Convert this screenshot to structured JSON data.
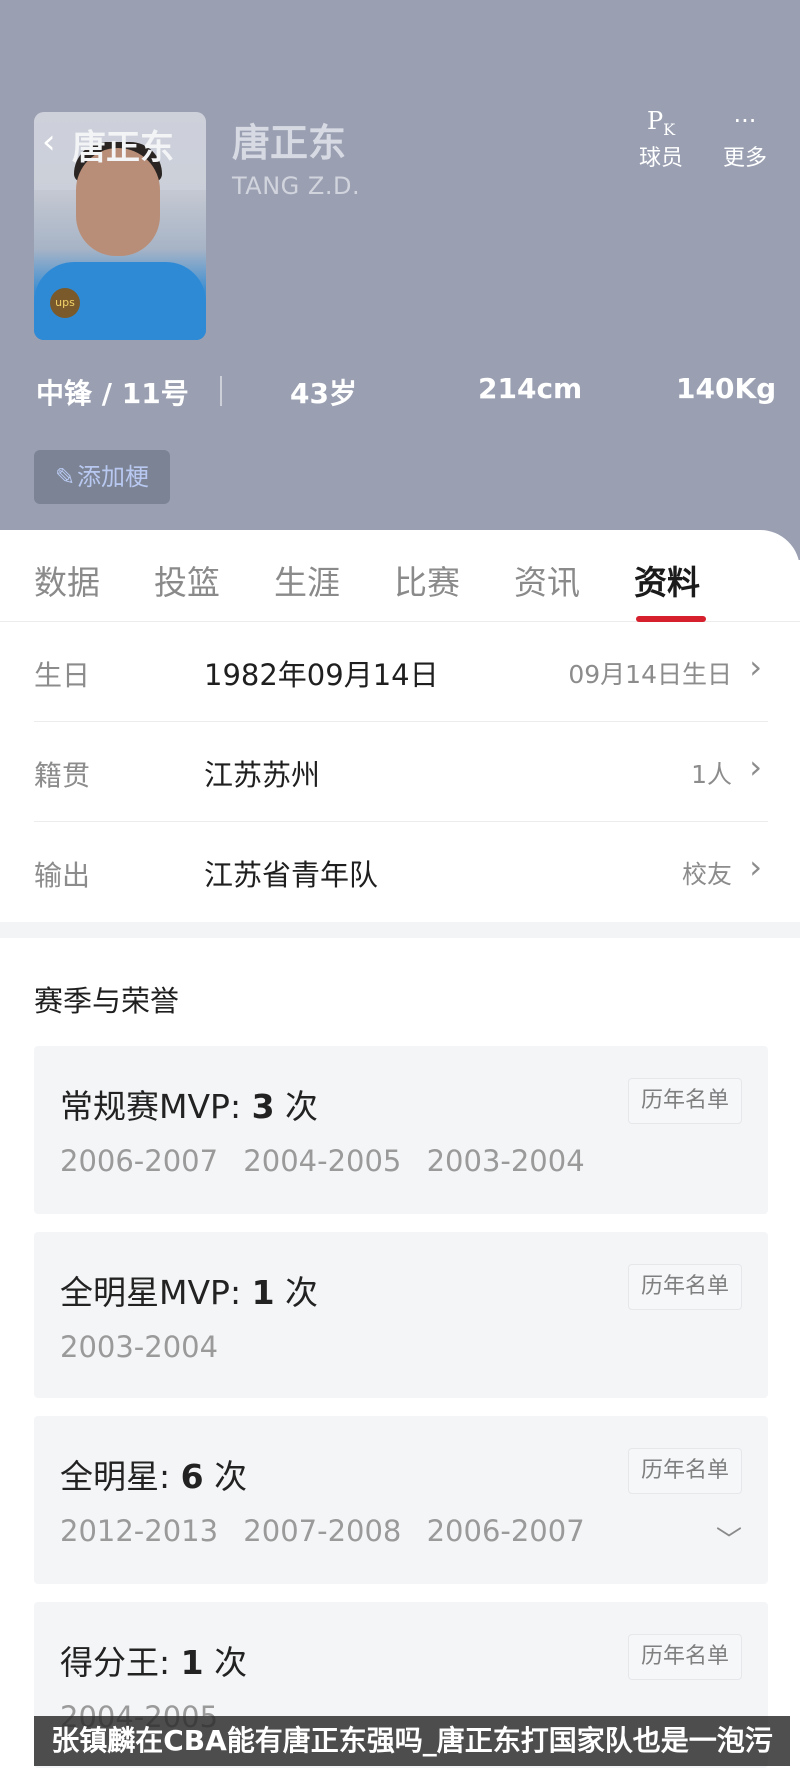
{
  "header": {
    "photo_overlay_name": "唐正东",
    "name_cn": "唐正东",
    "name_en": "TANG Z.D.",
    "jersey_logo_text": "ups",
    "actions": [
      {
        "icon": "pk-icon",
        "label": "球员"
      },
      {
        "icon": "more-icon",
        "label": "更多"
      }
    ],
    "info": {
      "position_number": "中锋 / 11号",
      "age": "43岁",
      "height": "214cm",
      "weight": "140Kg"
    },
    "add_button_label": "添加梗"
  },
  "tabs": [
    {
      "label": "数据",
      "active": false
    },
    {
      "label": "投篮",
      "active": false
    },
    {
      "label": "生涯",
      "active": false
    },
    {
      "label": "比赛",
      "active": false
    },
    {
      "label": "资讯",
      "active": false
    },
    {
      "label": "资料",
      "active": true
    }
  ],
  "profile": [
    {
      "key": "生日",
      "value": "1982年09月14日",
      "right": "09月14日生日"
    },
    {
      "key": "籍贯",
      "value": "江苏苏州",
      "right": "1人"
    },
    {
      "key": "输出",
      "value": "江苏省青年队",
      "right": "校友"
    }
  ],
  "honors_title": "赛季与荣誉",
  "honors": [
    {
      "title": "常规赛MVP: ",
      "count": "3",
      "unit": " 次",
      "years": [
        "2006-2007",
        "2004-2005",
        "2003-2004"
      ],
      "button": "历年名单"
    },
    {
      "title": "全明星MVP: ",
      "count": "1",
      "unit": " 次",
      "years": [
        "2003-2004"
      ],
      "button": "历年名单"
    },
    {
      "title": "全明星: ",
      "count": "6",
      "unit": " 次",
      "years": [
        "2012-2013",
        "2007-2008",
        "2006-2007"
      ],
      "button": "历年名单"
    },
    {
      "title": "得分王: ",
      "count": "1",
      "unit": " 次",
      "years": [
        "2004-2005"
      ],
      "button": "历年名单"
    }
  ],
  "caption": "张镇麟在CBA能有唐正东强吗_唐正东打国家队也是一泡污",
  "colors": {
    "header_bg": "#9aa0b2",
    "accent_red": "#d6202e",
    "card_bg": "#f4f5f7"
  }
}
